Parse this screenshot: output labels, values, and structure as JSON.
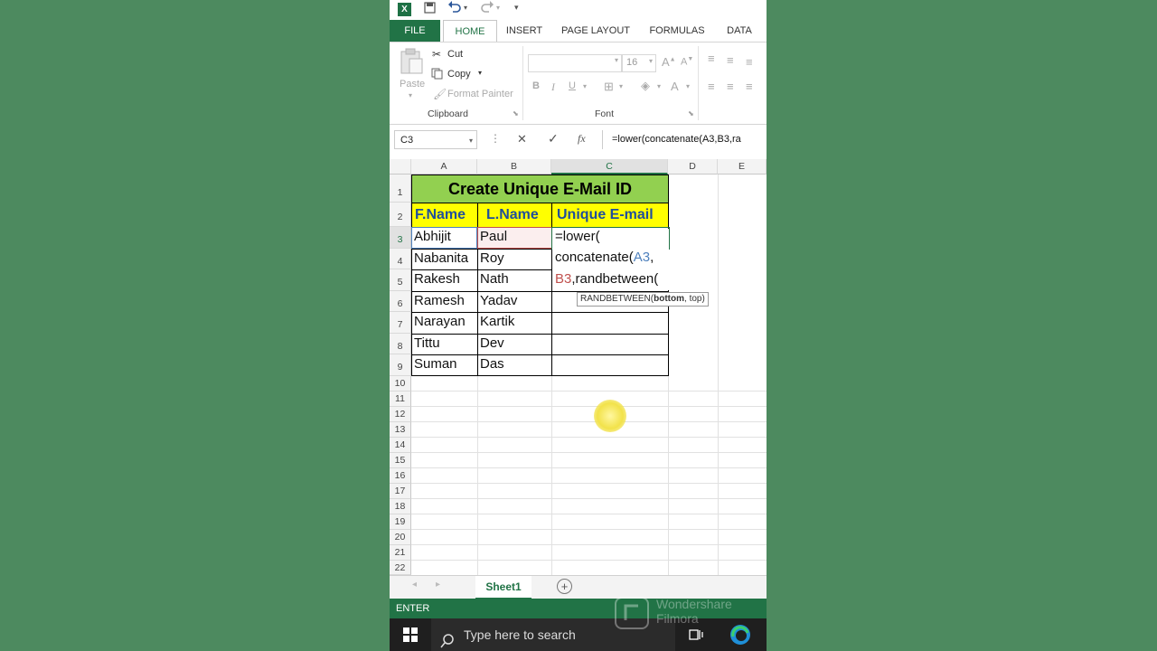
{
  "qat": {
    "excel_letter": "X",
    "save_icon": "save-icon",
    "undo_icon": "undo-icon",
    "redo_icon": "redo-icon"
  },
  "tabs": [
    "FILE",
    "HOME",
    "INSERT",
    "PAGE LAYOUT",
    "FORMULAS",
    "DATA"
  ],
  "clipboard": {
    "paste": "Paste",
    "cut": "Cut",
    "copy": "Copy",
    "format_painter": "Format Painter",
    "group_label": "Clipboard"
  },
  "font": {
    "size": "16",
    "bold": "B",
    "italic": "I",
    "underline": "U",
    "font_color": "A",
    "group_label": "Font"
  },
  "formula_bar": {
    "name_box": "C3",
    "cancel": "✕",
    "enter": "✓",
    "fx": "fx",
    "formula": "=lower(concatenate(A3,B3,ra"
  },
  "columns": [
    "A",
    "B",
    "C",
    "D",
    "E"
  ],
  "rows": [
    "1",
    "2",
    "3",
    "4",
    "5",
    "6",
    "7",
    "8",
    "9",
    "10",
    "11",
    "12",
    "13",
    "14",
    "15",
    "16",
    "17",
    "18",
    "19",
    "20",
    "21",
    "22"
  ],
  "sheet": {
    "title": "Create Unique E-Mail ID",
    "headers": [
      "F.Name",
      "L.Name",
      "Unique E-mail"
    ],
    "first_names": [
      "Abhijit",
      "Nabanita",
      "Rakesh",
      "Ramesh",
      "Narayan",
      "Tittu",
      "Suman"
    ],
    "last_names": [
      "Paul",
      "Roy",
      "Nath",
      "Yadav",
      "Kartik",
      "Dev",
      "Das"
    ],
    "edit_line1": "=lower(",
    "edit_line2_a": "concatenate(",
    "edit_line2_b": "A3",
    "edit_line2_c": ",",
    "edit_line3_a": "B3",
    "edit_line3_b": ",randbetween(",
    "tooltip_a": "RANDBETWEEN(",
    "tooltip_b": "bottom",
    "tooltip_c": ", top)"
  },
  "sheet_tab": "Sheet1",
  "status": "ENTER",
  "taskbar": {
    "search_placeholder": "Type here to search"
  },
  "watermark": {
    "line1": "Wondershare",
    "line2": "Filmora"
  },
  "colors": {
    "excel_green": "#217346",
    "title_fill": "#92d050",
    "header_fill": "#ffff00",
    "ref_a3": "#4f81bd",
    "ref_b3": "#c0504d"
  }
}
